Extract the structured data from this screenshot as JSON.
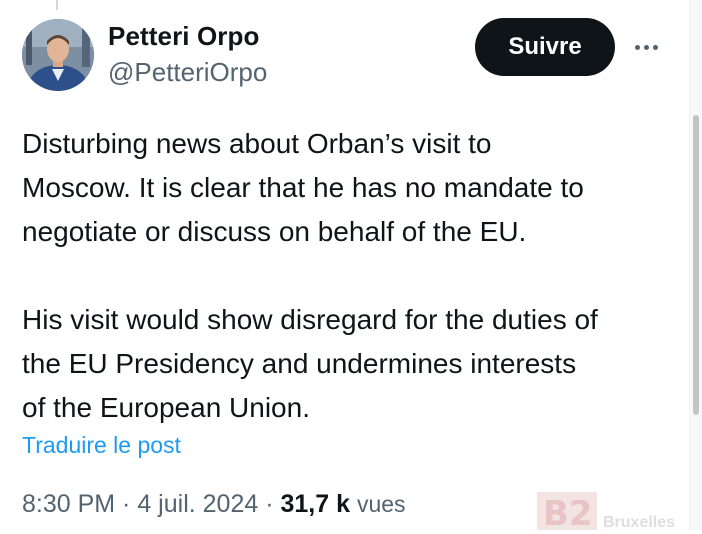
{
  "author": {
    "name": "Petteri Orpo",
    "handle": "@PetteriOrpo"
  },
  "follow_button": {
    "label": "Suivre"
  },
  "tweet": {
    "paragraphs": [
      "Disturbing news about Orban’s visit to\nMoscow. It is clear that he has no mandate to\nnegotiate or discuss on behalf of the EU.",
      "His visit would show disregard for the duties of\nthe EU Presidency and undermines interests\nof the European Union."
    ],
    "translate_label": "Traduire le post"
  },
  "meta": {
    "time": "8:30 PM",
    "separator1": " · ",
    "date": "4 juil. 2024",
    "separator2": " · ",
    "views_count": "31,7 k",
    "views_label": "vues"
  },
  "watermark": {
    "letter": "B2",
    "word": "Bruxelles"
  },
  "colors": {
    "text": "#0f1419",
    "secondary": "#536471",
    "link": "#1d9bf0",
    "button_bg": "#0f1419"
  },
  "icons": {
    "more": "more-horizontal-icon"
  }
}
